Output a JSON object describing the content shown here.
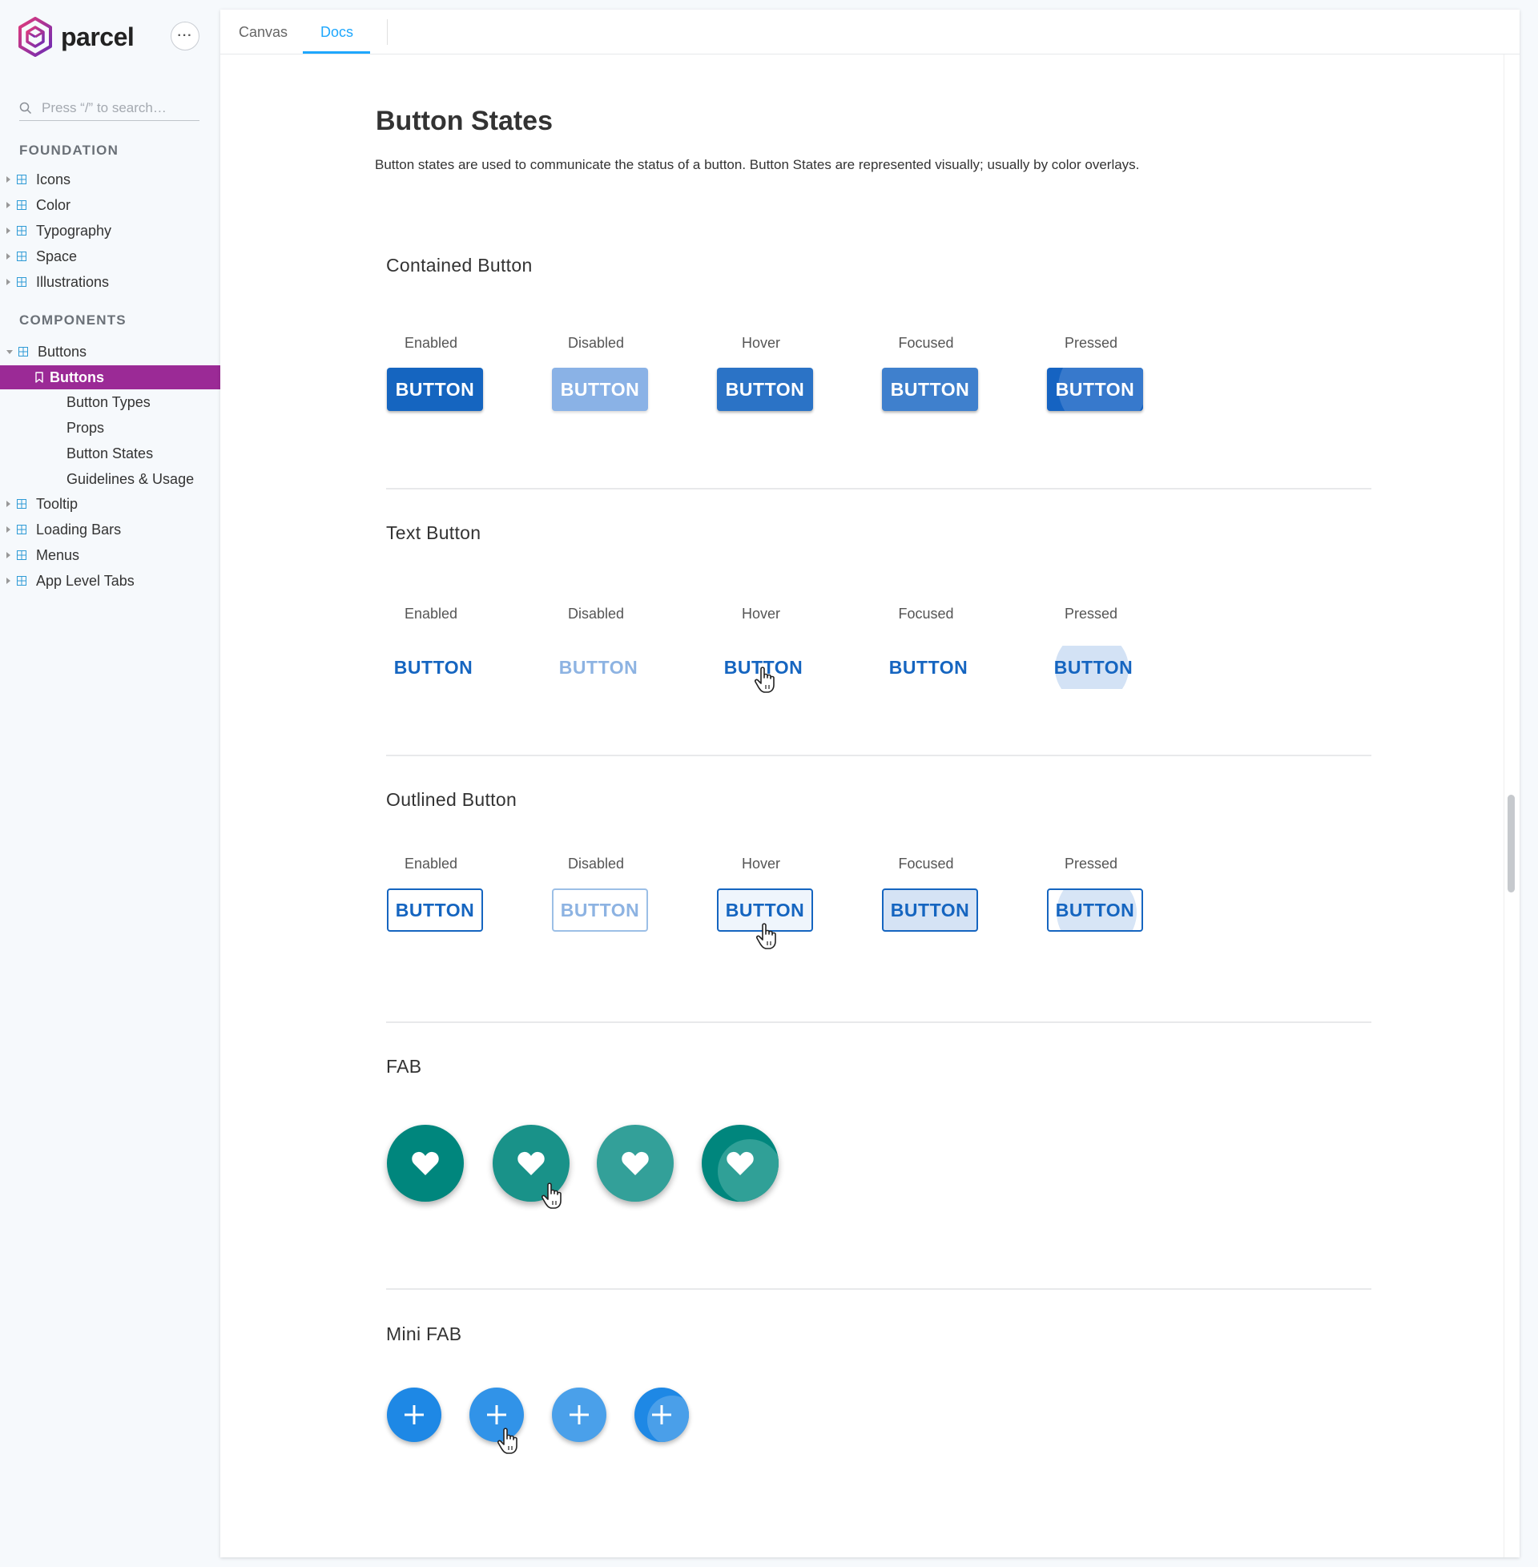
{
  "app": {
    "name": "parcel",
    "more_label": "···"
  },
  "search": {
    "placeholder": "Press “/” to search…"
  },
  "sidebar": {
    "foundation_heading": "FOUNDATION",
    "foundation_items": [
      "Icons",
      "Color",
      "Typography",
      "Space",
      "Illustrations"
    ],
    "components_heading": "COMPONENTS",
    "buttons_group": "Buttons",
    "active_item": "Buttons",
    "sub_items": [
      "Button Types",
      "Props",
      "Button States",
      "Guidelines & Usage"
    ],
    "more_components": [
      "Tooltip",
      "Loading Bars",
      "Menus",
      "App Level Tabs"
    ]
  },
  "tabs": [
    {
      "label": "Canvas",
      "active": false
    },
    {
      "label": "Docs",
      "active": true
    }
  ],
  "page": {
    "title": "Button States",
    "intro": "Button states are used to communicate the status of a button. Button States are represented visually; usually by color overlays.",
    "states": [
      "Enabled",
      "Disabled",
      "Hover",
      "Focused",
      "Pressed"
    ],
    "button_label": "BUTTON",
    "sections": {
      "contained": "Contained Button",
      "text": "Text Button",
      "outlined": "Outlined Button",
      "fab": "FAB",
      "mini_fab": "Mini FAB"
    }
  },
  "colors": {
    "accent": "#1ea7fd",
    "active_sidebar": "#9b2a96",
    "primary_button": "#1565c0",
    "fab": "#00867d",
    "mini_fab": "#1e88e5"
  },
  "icons": {
    "fab": "heart-icon",
    "mini_fab": "plus-icon",
    "cursor": "hand-cursor-icon"
  }
}
